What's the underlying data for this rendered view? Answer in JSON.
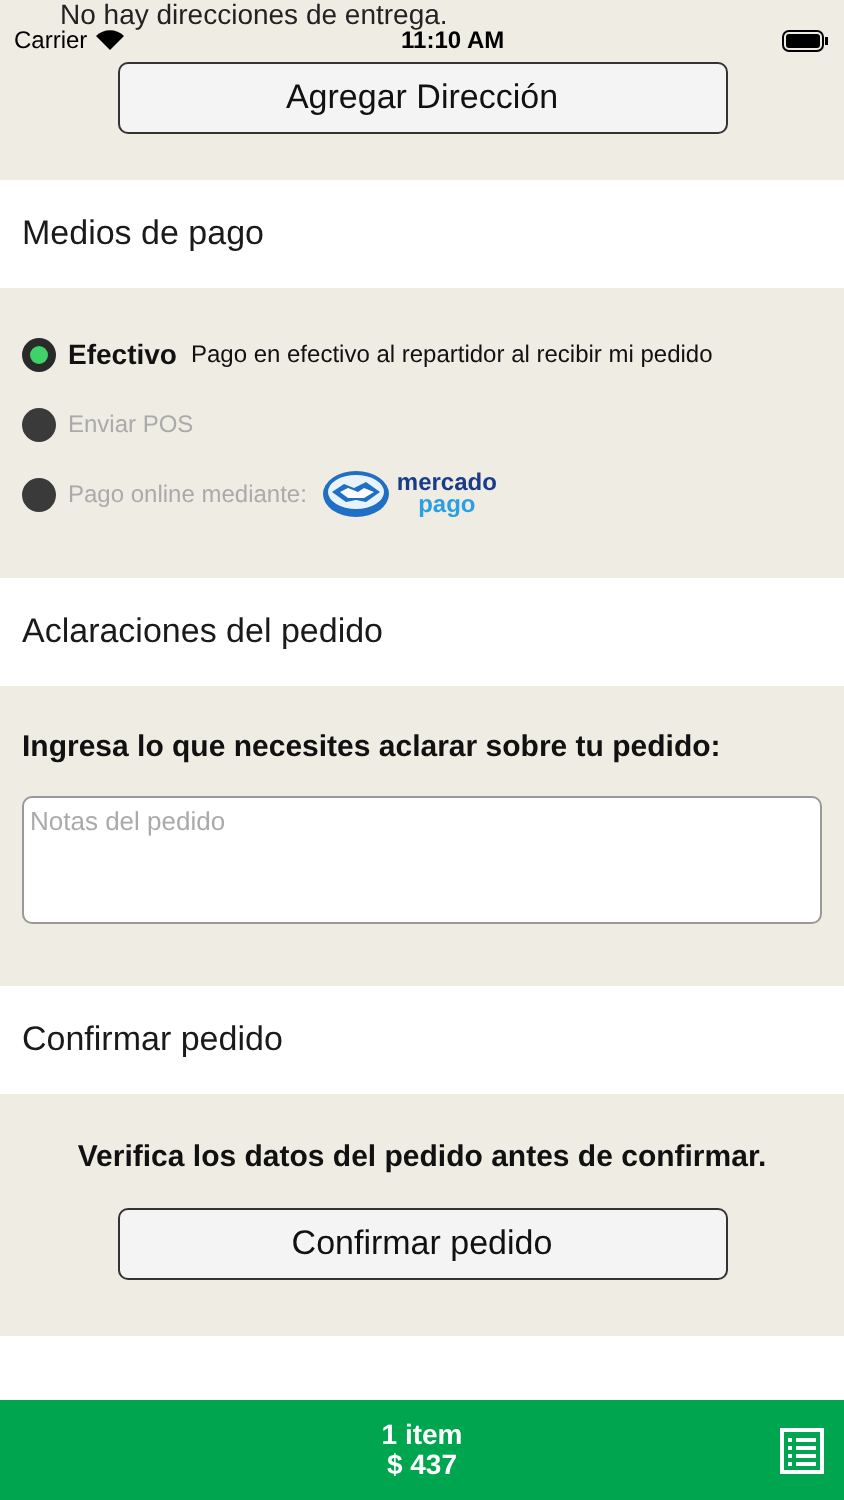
{
  "top_message": "No hay direcciones de entrega.",
  "status_bar": {
    "carrier": "Carrier",
    "time": "11:10 AM"
  },
  "add_address_button": "Agregar Dirección",
  "payment": {
    "title": "Medios de pago",
    "options": [
      {
        "label": "Efectivo",
        "description": "Pago en efectivo al repartidor al recibir mi pedido",
        "selected": true
      },
      {
        "label": "Enviar POS",
        "selected": false
      },
      {
        "label": "Pago online mediante:",
        "logo": {
          "line_1": "mercado",
          "line_2": "pago"
        },
        "selected": false
      }
    ]
  },
  "notes": {
    "title": "Aclaraciones del pedido",
    "prompt": "Ingresa lo que necesites aclarar sobre tu pedido:",
    "placeholder": "Notas del pedido"
  },
  "confirm": {
    "title": "Confirmar pedido",
    "message": "Verifica los datos del pedido antes de confirmar.",
    "button": "Confirmar pedido"
  },
  "cart_bar": {
    "count": "1 item",
    "total": "$ 437"
  }
}
